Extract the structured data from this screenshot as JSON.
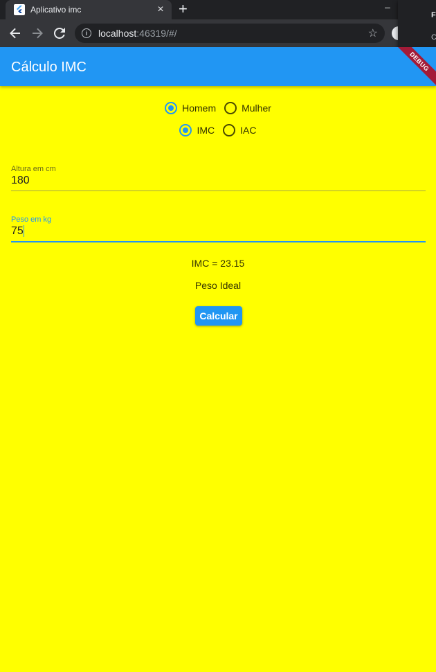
{
  "browser": {
    "tab_title": "Aplicativo imc",
    "url_host": "localhost",
    "url_path": ":46319/#/",
    "popup_line1": "F",
    "popup_line2": "C"
  },
  "app": {
    "title": "Cálculo IMC",
    "debug_banner": "DEBUG",
    "accent_color": "#2196f3",
    "background_color": "#ffff00"
  },
  "sex_options": [
    {
      "label": "Homem",
      "selected": true
    },
    {
      "label": "Mulher",
      "selected": false
    }
  ],
  "index_options": [
    {
      "label": "IMC",
      "selected": true
    },
    {
      "label": "IAC",
      "selected": false
    }
  ],
  "height_field": {
    "label": "Altura em cm",
    "value": "180"
  },
  "weight_field": {
    "label": "Peso em kg",
    "value": "75"
  },
  "result": {
    "imc_text": "IMC = 23.15",
    "status_text": "Peso Ideal"
  },
  "calculate_button": "Calcular"
}
